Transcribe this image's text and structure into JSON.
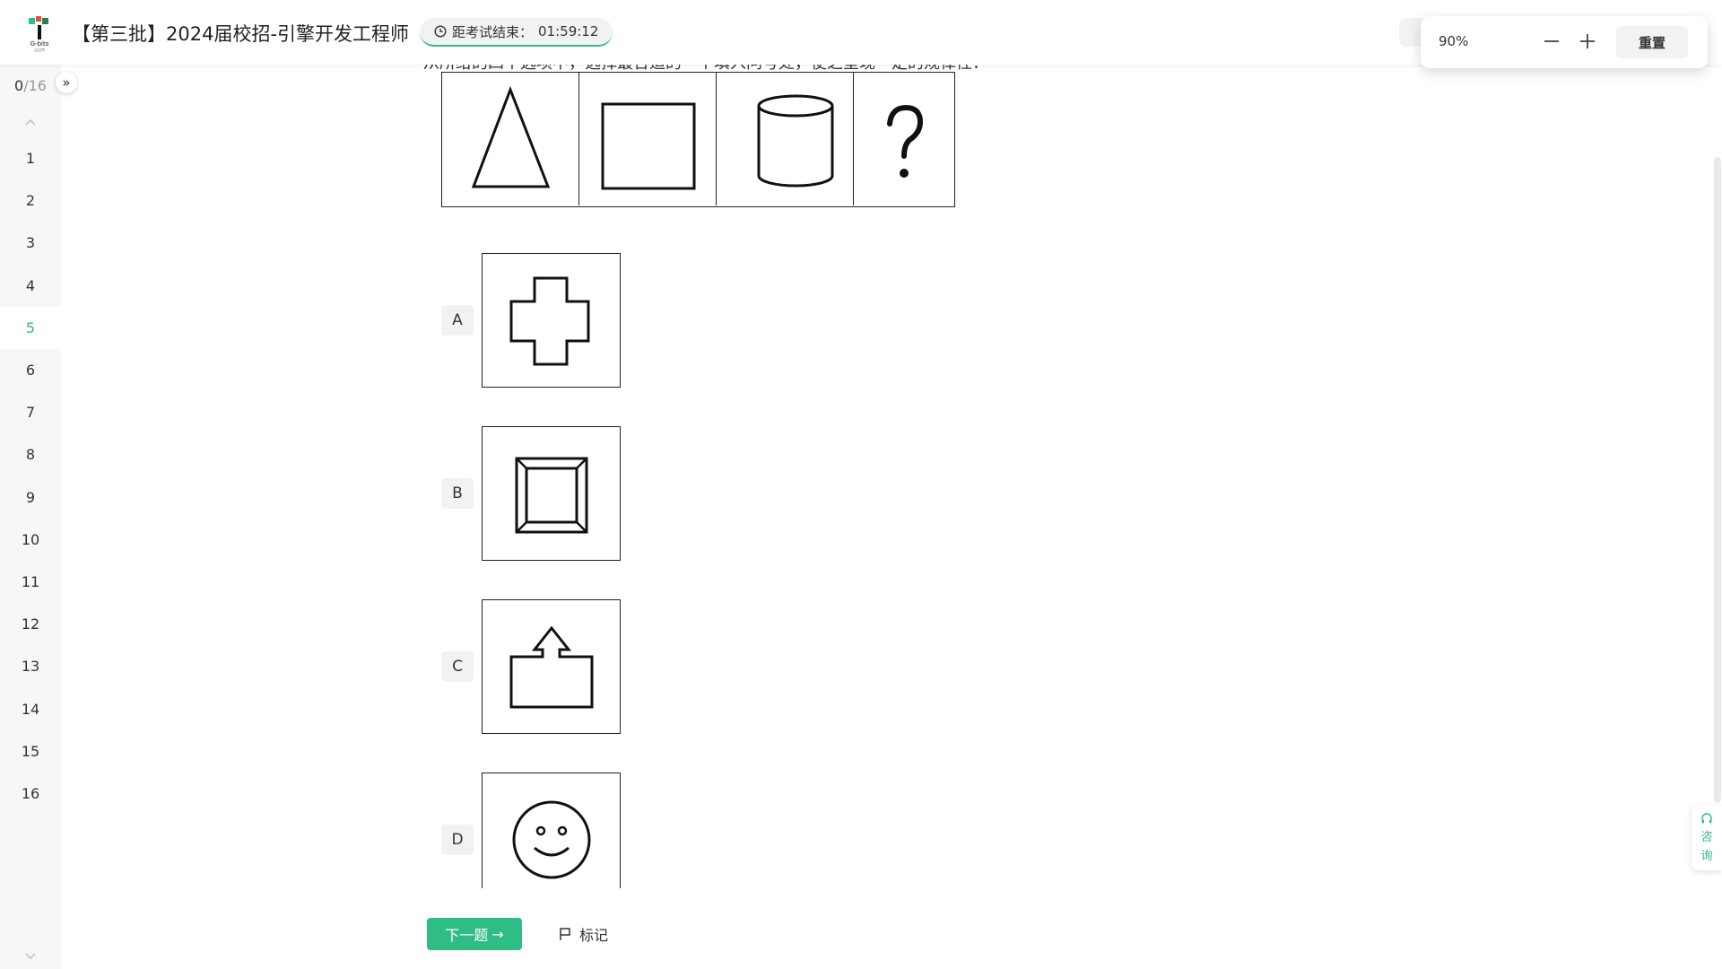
{
  "header": {
    "title": "【第三批】2024届校招-引擎开发工程师",
    "timer_label": "距考试结束：",
    "timer_value": "01:59:12"
  },
  "zoom": {
    "value": "90%",
    "reset_label": "重置"
  },
  "sidebar": {
    "answered": "0",
    "total": "/16",
    "collapse_glyph": "»",
    "current": 5,
    "questions": [
      "1",
      "2",
      "3",
      "4",
      "5",
      "6",
      "7",
      "8",
      "9",
      "10",
      "11",
      "12",
      "13",
      "14",
      "15",
      "16"
    ]
  },
  "question": {
    "text": "从所给的四个选项中，选择最合适的一个填入问号处，使之呈现一定的规律性：",
    "sequence": [
      "triangle-figure",
      "square-figure",
      "cylinder-figure",
      "question-mark"
    ],
    "options": [
      {
        "letter": "A",
        "figure": "cross-figure"
      },
      {
        "letter": "B",
        "figure": "frame-figure"
      },
      {
        "letter": "C",
        "figure": "house-arrow-figure"
      },
      {
        "letter": "D",
        "figure": "smiley-figure"
      }
    ]
  },
  "actions": {
    "next_label": "下一题",
    "next_arrow": "→",
    "mark_label": "标记"
  },
  "consult": {
    "label_1": "咨",
    "label_2": "询"
  },
  "colors": {
    "accent": "#2ebd85",
    "sidebar_bg": "#f7f7f7"
  }
}
